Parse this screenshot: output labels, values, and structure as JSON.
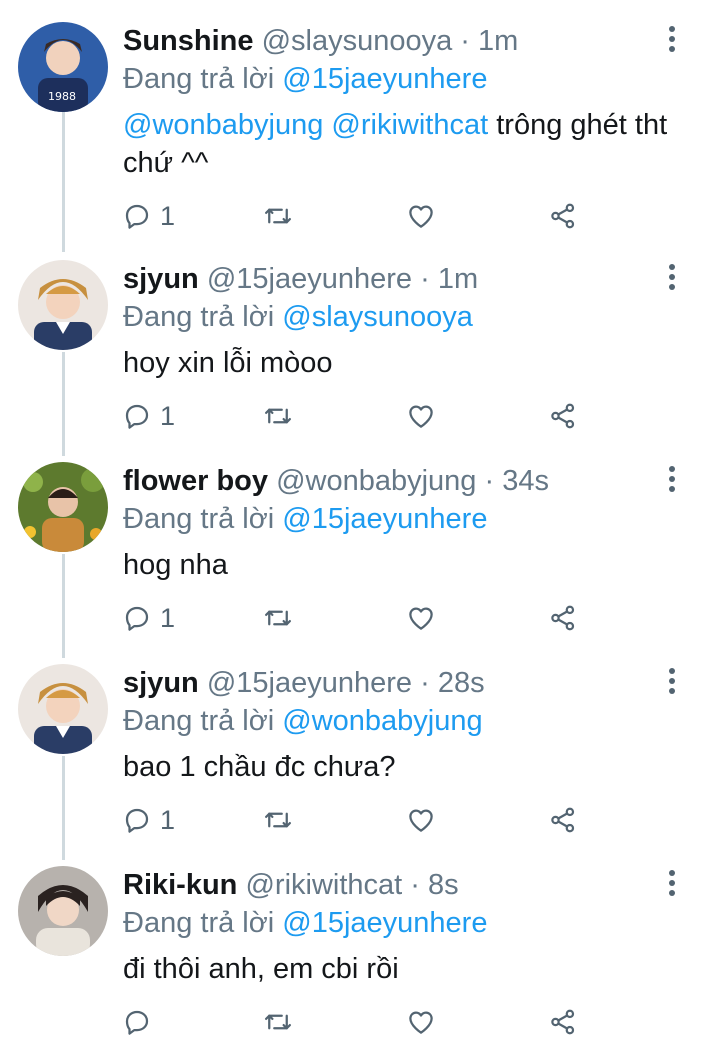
{
  "reply_prefix": "Đang trả lời",
  "colors": {
    "link": "#1d9bf0",
    "meta": "#657786",
    "text": "#14171a",
    "icon": "#536471"
  },
  "tweets": [
    {
      "name": "Sunshine",
      "handle": "@slaysunooya",
      "time": "1m",
      "replying_to": "@15jaeyunhere",
      "mention1": "@wonbabyjung",
      "mention2": "@rikiwithcat",
      "text": "trông ghét tht chứ ^^",
      "reply_count": "1"
    },
    {
      "name": "sjyun",
      "handle": "@15jaeyunhere",
      "time": "1m",
      "replying_to": "@slaysunooya",
      "text": "hoy xin lỗi mòoo",
      "reply_count": "1"
    },
    {
      "name": "flower boy",
      "handle": "@wonbabyjung",
      "time": "34s",
      "replying_to": "@15jaeyunhere",
      "text": "hog nha",
      "reply_count": "1"
    },
    {
      "name": "sjyun",
      "handle": "@15jaeyunhere",
      "time": "28s",
      "replying_to": "@wonbabyjung",
      "text": "bao 1 chầu đc chưa?",
      "reply_count": "1"
    },
    {
      "name": "Riki-kun",
      "handle": "@rikiwithcat",
      "time": "8s",
      "replying_to": "@15jaeyunhere",
      "text": "đi thôi anh, em cbi rồi",
      "reply_count": ""
    }
  ]
}
